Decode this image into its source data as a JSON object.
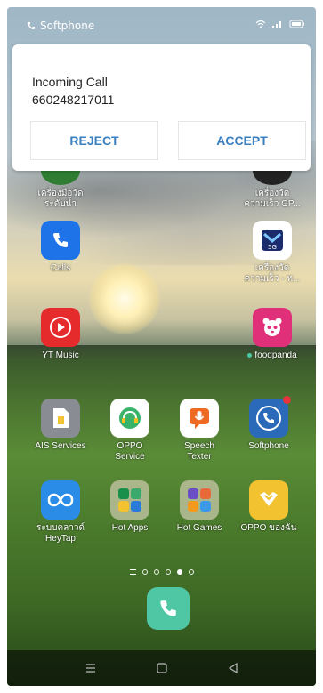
{
  "status_bar": {
    "app_name": "Softphone"
  },
  "incoming_call": {
    "title": "Incoming Call",
    "number": "660248217011",
    "reject_label": "REJECT",
    "accept_label": "ACCEPT"
  },
  "partial_row": {
    "left_label": "เครื่องมือวัด\nระดับน้ำ",
    "right_label": "เครื่องวัด\nความเร็ว GP..."
  },
  "apps": [
    {
      "label": "Calls"
    },
    {
      "label": "เครื่องวัด\nความเร็ว - ท..."
    },
    {
      "label": "YT Music"
    },
    {
      "label": "foodpanda"
    },
    {
      "label": "AIS Services"
    },
    {
      "label": "OPPO\nService"
    },
    {
      "label": "Speech\nTexter"
    },
    {
      "label": "Softphone"
    },
    {
      "label": "ระบบคลาวด์\nHeyTap"
    },
    {
      "label": "Hot Apps"
    },
    {
      "label": "Hot Games"
    },
    {
      "label": "OPPO ของฉัน"
    }
  ],
  "icons": {
    "calls": "phone-icon",
    "speed": "speedometer-5g-icon",
    "ytmusic": "play-circle-icon",
    "foodpanda": "panda-icon",
    "ais": "sim-card-icon",
    "oppo_service": "headset-icon",
    "speech_texter": "microphone-icon",
    "softphone": "phone-circle-icon",
    "heytap": "cloud-loop-icon",
    "hot_apps": "folder-icon",
    "hot_games": "folder-icon",
    "oppo_mine": "heart-badge-icon"
  },
  "colors": {
    "accent_button_text": "#3a7fbf",
    "dock_phone": "#4fc7a5",
    "notification_dot": "#e5343b"
  }
}
